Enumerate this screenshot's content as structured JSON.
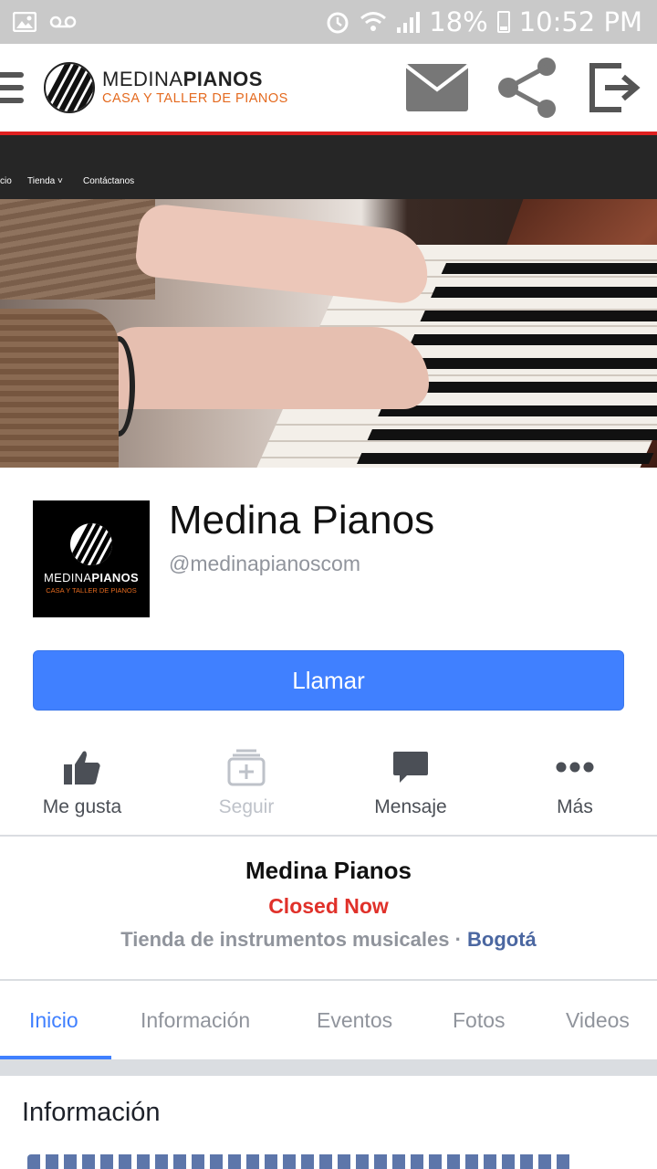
{
  "status_bar": {
    "battery": "18%",
    "time": "10:52 PM"
  },
  "app_header": {
    "brand_light": "MEDINA",
    "brand_bold": "PIANOS",
    "tagline": "CASA Y TALLER DE PIANOS",
    "icons": [
      "menu-icon",
      "mail-icon",
      "share-icon",
      "logout-icon"
    ]
  },
  "cover": {
    "nav_items": [
      "cio",
      "Tienda ˅",
      "Contáctanos"
    ]
  },
  "profile": {
    "avatar_light": "MEDINA",
    "avatar_bold": "PIANOS",
    "avatar_tagline": "CASA Y TALLER DE PIANOS",
    "name": "Medina Pianos",
    "handle": "@medinapianoscom"
  },
  "call_button": {
    "label": "Llamar",
    "color": "#4080ff"
  },
  "actions": [
    {
      "label": "Me gusta",
      "icon": "thumbs-up-icon"
    },
    {
      "label": "Seguir",
      "icon": "follow-icon"
    },
    {
      "label": "Mensaje",
      "icon": "message-icon"
    },
    {
      "label": "Más",
      "icon": "more-icon"
    }
  ],
  "info_card": {
    "title": "Medina Pianos",
    "status": "Closed Now",
    "category": "Tienda de instrumentos musicales",
    "separator": "·",
    "city": "Bogotá"
  },
  "tabs": [
    {
      "label": "Inicio",
      "active": true
    },
    {
      "label": "Información"
    },
    {
      "label": "Eventos"
    },
    {
      "label": "Fotos"
    },
    {
      "label": "Videos"
    }
  ],
  "section": {
    "title": "Información"
  }
}
